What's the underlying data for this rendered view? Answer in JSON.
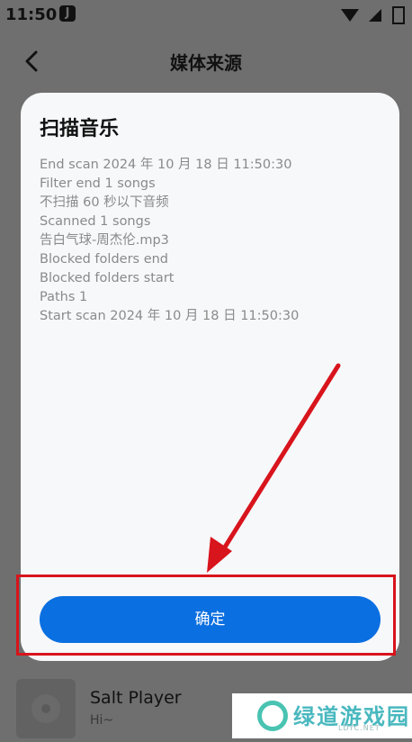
{
  "status_bar": {
    "time": "11:50",
    "app_icon_letter": "J"
  },
  "nav": {
    "title": "媒体来源",
    "back_icon": "chevron-left-icon"
  },
  "dialog": {
    "title": "扫描音乐",
    "log_lines": [
      "End scan 2024 年 10 月 18 日 11:50:30",
      "Filter end 1 songs",
      "不扫描 60 秒以下音频",
      "Scanned 1 songs",
      "告白气球-周杰伦.mp3",
      "Blocked folders end",
      "Blocked folders start",
      "Paths 1",
      "Start scan 2024 年 10 月 18 日 11:50:30"
    ],
    "confirm_label": "确定"
  },
  "player": {
    "title": "Salt Player",
    "subtitle": "Hi~"
  },
  "watermark": {
    "brand": "绿道游戏园",
    "domain": "LDYC.NET"
  },
  "colors": {
    "accent": "#0a6fe0",
    "annotation": "#d8141c",
    "overlay": "#6f6f6f"
  }
}
